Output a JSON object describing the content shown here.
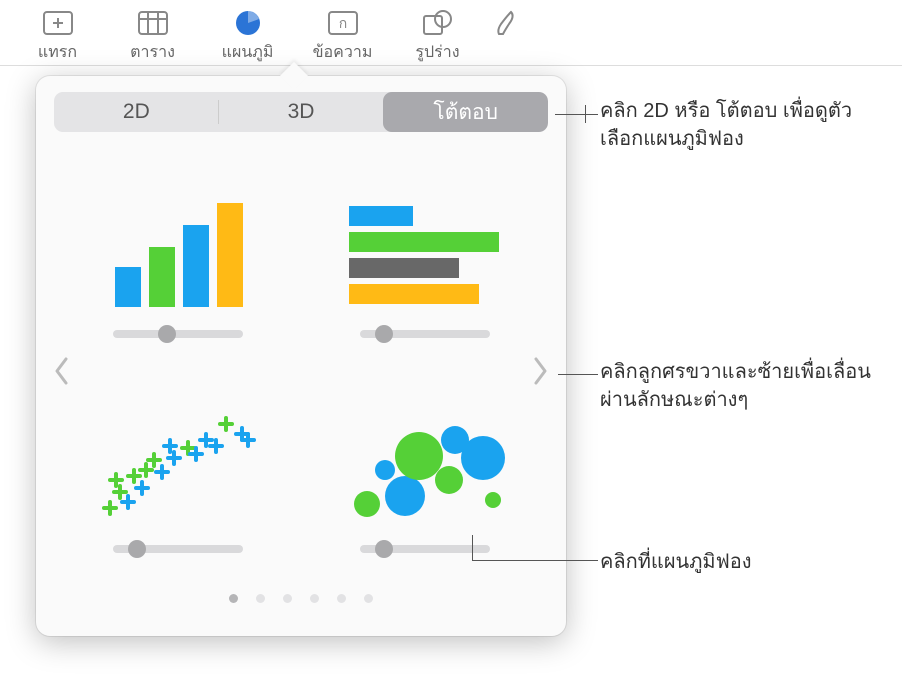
{
  "toolbar": {
    "items": [
      {
        "label": "แทรก",
        "icon": "insert"
      },
      {
        "label": "ตาราง",
        "icon": "table"
      },
      {
        "label": "แผนภูมิ",
        "icon": "chart",
        "active": true
      },
      {
        "label": "ข้อความ",
        "icon": "text"
      },
      {
        "label": "รูปร่าง",
        "icon": "shape"
      }
    ]
  },
  "popover": {
    "tabs": {
      "t2d": "2D",
      "t3d": "3D",
      "interactive": "โต้ตอบ"
    },
    "charts": [
      {
        "name": "bar-vertical",
        "slider_pos": 0.35
      },
      {
        "name": "bar-horizontal",
        "slider_pos": 0.12
      },
      {
        "name": "scatter-plus",
        "slider_pos": 0.12
      },
      {
        "name": "bubble",
        "slider_pos": 0.12
      }
    ],
    "page_count": 6,
    "page_active": 0
  },
  "callouts": {
    "tabs": "คลิก 2D หรือ โต้ตอบ เพื่อดูตัวเลือกแผนภูมิฟอง",
    "arrows": "คลิกลูกศรขวาและซ้ายเพื่อเลื่อนผ่านลักษณะต่างๆ",
    "bubble": "คลิกที่แผนภูมิฟอง"
  }
}
